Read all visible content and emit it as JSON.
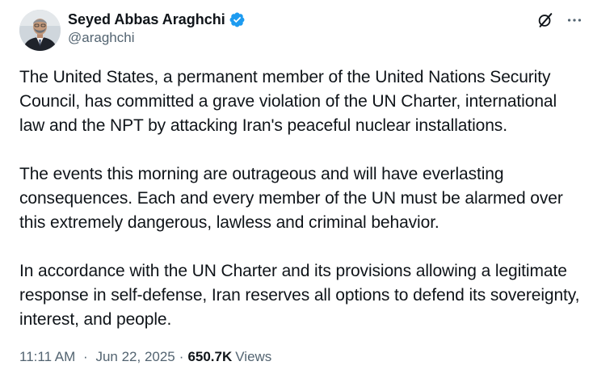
{
  "author": {
    "display_name": "Seyed Abbas Araghchi",
    "handle": "@araghchi",
    "verified": true,
    "verified_color": "#1d9bf0"
  },
  "icons": {
    "grok": "grok-icon",
    "more": "more-icon"
  },
  "tweet": {
    "paragraphs": [
      "The United States, a permanent member of the United Nations Security Council, has committed a grave violation of the UN Charter, international law and the NPT by attacking Iran's peaceful nuclear installations.",
      "The events this morning are outrageous and will have everlasting consequences. Each and every member of the UN must be alarmed over this extremely dangerous, lawless and criminal behavior.",
      "In accordance with the UN Charter and its provisions allowing a legitimate response in self-defense, Iran reserves all options to defend its sovereignty, interest, and people."
    ]
  },
  "meta": {
    "time": "11:11 AM",
    "separator": "·",
    "date": "Jun 22, 2025",
    "views_count": "650.7K",
    "views_label": "Views"
  },
  "colors": {
    "text_primary": "#0f1419",
    "text_secondary": "#536471"
  }
}
